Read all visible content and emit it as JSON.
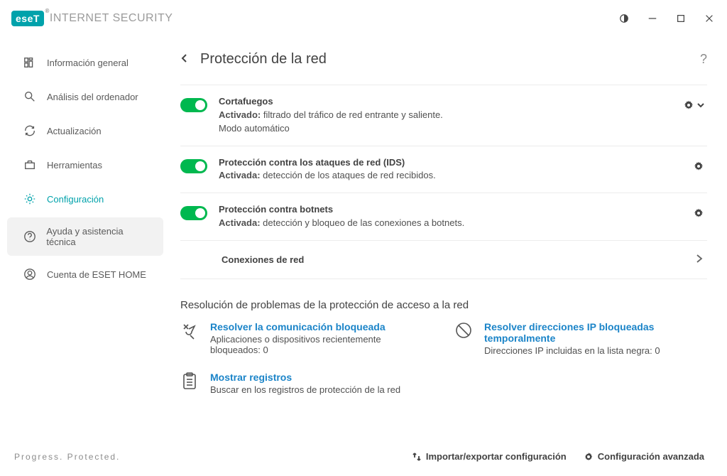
{
  "titlebar": {
    "logo_label": "eseT",
    "product": "INTERNET SECURITY"
  },
  "sidebar": {
    "items": [
      {
        "label": "Información general"
      },
      {
        "label": "Análisis del ordenador"
      },
      {
        "label": "Actualización"
      },
      {
        "label": "Herramientas"
      },
      {
        "label": "Configuración"
      },
      {
        "label": "Ayuda y asistencia técnica"
      },
      {
        "label": "Cuenta de ESET HOME"
      }
    ],
    "tagline": "Progress. Protected."
  },
  "header": {
    "title": "Protección de la red"
  },
  "modules": [
    {
      "title": "Cortafuegos",
      "status_label": "Activado:",
      "status_desc": "filtrado del tráfico de red entrante y saliente.",
      "extra": "Modo automático"
    },
    {
      "title": "Protección contra los ataques de red (IDS)",
      "status_label": "Activada:",
      "status_desc": "detección de los ataques de red recibidos."
    },
    {
      "title": "Protección contra botnets",
      "status_label": "Activada:",
      "status_desc": "detección y bloqueo de las conexiones a botnets."
    }
  ],
  "connections_row": {
    "label": "Conexiones de red"
  },
  "troubleshoot": {
    "heading": "Resolución de problemas de la protección de acceso a la red",
    "cards": [
      {
        "title": "Resolver la comunicación bloqueada",
        "desc": "Aplicaciones o dispositivos recientemente bloqueados: 0"
      },
      {
        "title": "Resolver direcciones IP bloqueadas temporalmente",
        "desc": "Direcciones IP incluidas en la lista negra: 0"
      },
      {
        "title": "Mostrar registros",
        "desc": "Buscar en los registros de protección de la red"
      }
    ]
  },
  "footer": {
    "import_export": "Importar/exportar configuración",
    "advanced": "Configuración avanzada"
  }
}
